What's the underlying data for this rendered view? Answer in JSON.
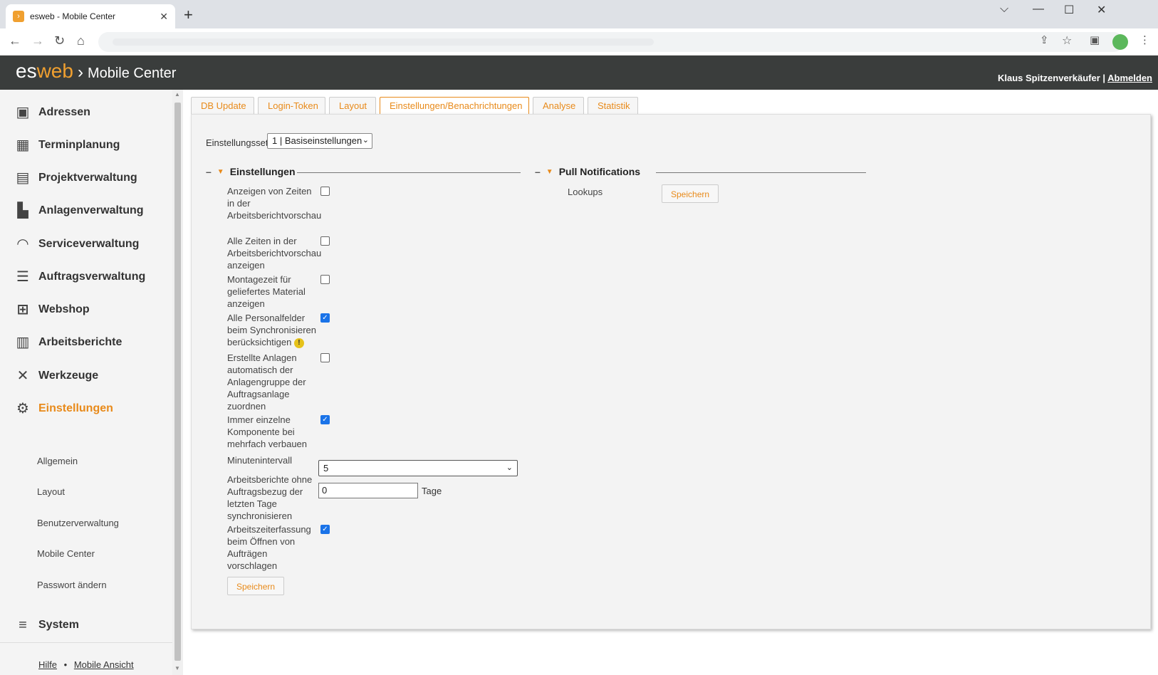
{
  "browser": {
    "tab_title": "esweb - Mobile Center",
    "tab_close": "✕",
    "new_tab": "+",
    "win_controls": [
      "⌵",
      "—",
      "☐",
      "✕"
    ]
  },
  "app": {
    "logo_es": "es",
    "logo_web": "web",
    "logo_chevron": "›",
    "title": "Mobile Center",
    "user_name": "Klaus Spitzenverkäufer |",
    "logout": "Abmelden"
  },
  "sidebar": {
    "items": [
      {
        "label": "Adressen",
        "icon": "address-book-icon"
      },
      {
        "label": "Terminplanung",
        "icon": "calendar-icon"
      },
      {
        "label": "Projektverwaltung",
        "icon": "gantt-icon"
      },
      {
        "label": "Anlagenverwaltung",
        "icon": "factory-icon"
      },
      {
        "label": "Serviceverwaltung",
        "icon": "headset-icon"
      },
      {
        "label": "Auftragsverwaltung",
        "icon": "list-icon"
      },
      {
        "label": "Webshop",
        "icon": "cart-icon"
      },
      {
        "label": "Arbeitsberichte",
        "icon": "clipboard-icon"
      },
      {
        "label": "Werkzeuge",
        "icon": "tools-icon"
      },
      {
        "label": "Einstellungen",
        "icon": "gears-icon"
      }
    ],
    "subitems": [
      "Allgemein",
      "Layout",
      "Benutzerverwaltung",
      "Mobile Center",
      "Passwort ändern"
    ],
    "system": "System",
    "footer": {
      "help": "Hilfe",
      "sep": "•",
      "mobile": "Mobile Ansicht"
    }
  },
  "tabs": [
    "DB Update",
    "Login-Token",
    "Layout",
    "Einstellungen/Benachrichtungen",
    "Analyse",
    "Statistik"
  ],
  "active_tab": "Einstellungen/Benachrichtungen",
  "settingsset": {
    "label": "Einstellungsset",
    "value": "1 | Basiseinstellungen"
  },
  "einstellungen": {
    "title": "Einstellungen",
    "fields": [
      {
        "label": "Anzeigen von Zeiten in der Arbeitsberichtvorschau",
        "checked": false
      },
      {
        "label": "Alle Zeiten in der Arbeitsberichtvorschau anzeigen",
        "checked": false
      },
      {
        "label": "Montagezeit für geliefertes Material anzeigen",
        "checked": false
      },
      {
        "label": "Alle Personalfelder beim Synchronisieren berücksichtigen",
        "checked": true
      },
      {
        "label": "Erstellte Anlagen automatisch der Anlagengruppe der Auftragsanlage zuordnen",
        "checked": false
      },
      {
        "label": "Immer einzelne Komponente bei mehrfach verbauen",
        "checked": true
      },
      {
        "label": "Arbeitszeiterfassung beim Öffnen von Aufträgen vorschlagen",
        "checked": true
      }
    ],
    "minuteninterval_label": "Minutenintervall",
    "minuteninterval_value": "5",
    "days_label": "Arbeitsberichte ohne Auftragsbezug der letzten Tage synchronisieren",
    "days_value": "0",
    "days_unit": "Tage",
    "save": "Speichern"
  },
  "pull": {
    "title": "Pull Notifications",
    "lookups_label": "Lookups",
    "save": "Speichern"
  },
  "glyphs": {
    "dash": "–",
    "tri": "▼",
    "check": "✓",
    "warn": "!",
    "arrow": "⌄"
  }
}
